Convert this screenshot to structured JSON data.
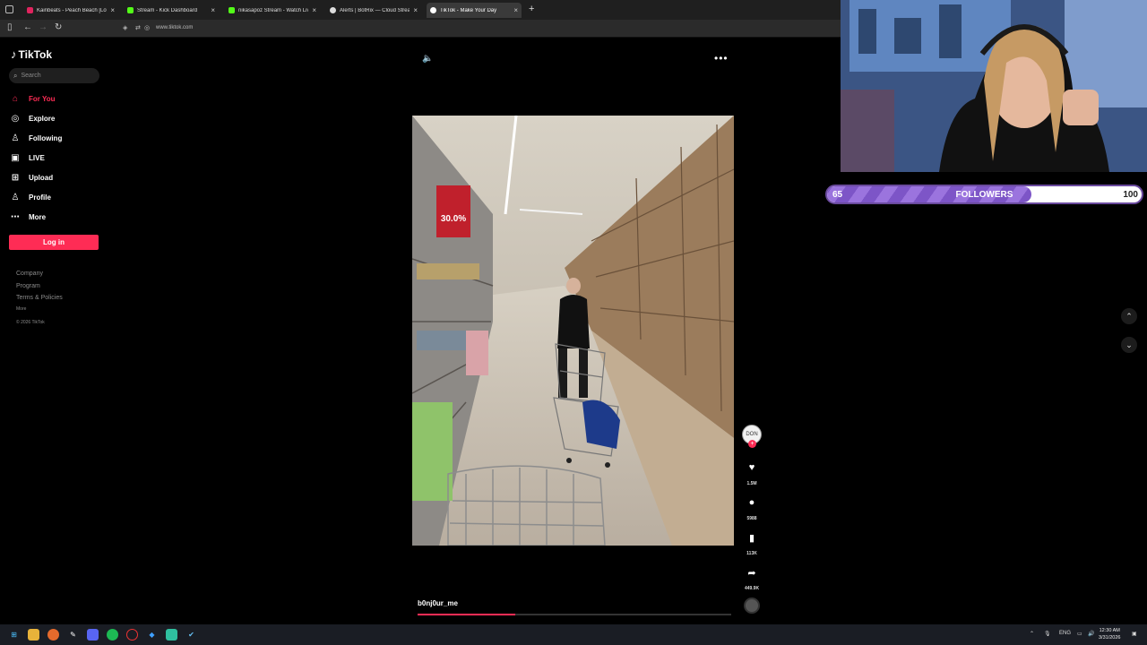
{
  "browser": {
    "tabs": [
      {
        "title": "Kainbeats - Peach Beach [Lofi H",
        "favicon_color": "#e0245e"
      },
      {
        "title": "Stream - Kick Dashboard",
        "favicon_color": "#53fc18"
      },
      {
        "title": "nikasapoz Stream - Watch Live",
        "favicon_color": "#53fc18"
      },
      {
        "title": "Alerts | BotRix — Cloud Stream",
        "favicon_color": "#dddddd"
      },
      {
        "title": "TikTok - Make Your Day",
        "favicon_color": "#ffffff"
      }
    ],
    "active_tab": 4,
    "url": "www.tiktok.com"
  },
  "tiktok": {
    "logo": "TikTok",
    "search_placeholder": "Search",
    "nav": [
      {
        "label": "For You",
        "icon": "home-icon",
        "active": true
      },
      {
        "label": "Explore",
        "icon": "compass-icon",
        "active": false
      },
      {
        "label": "Following",
        "icon": "user-follow-icon",
        "active": false
      },
      {
        "label": "LIVE",
        "icon": "live-icon",
        "active": false
      },
      {
        "label": "Upload",
        "icon": "upload-icon",
        "active": false
      },
      {
        "label": "Profile",
        "icon": "profile-icon",
        "active": false
      },
      {
        "label": "More",
        "icon": "more-icon",
        "active": false
      }
    ],
    "login_label": "Log in",
    "footer": {
      "company": "Company",
      "program": "Program",
      "terms": "Terms & Policies",
      "more": "More",
      "copyright": "© 2026 TikTok"
    },
    "video": {
      "username": "b0nj0ur_me",
      "avatar_text": "DON",
      "likes": "1.5M",
      "comments": "5988",
      "saves": "113K",
      "shares": "449.9K",
      "progress": 0.31,
      "sign_text": "30.0%"
    }
  },
  "overlay": {
    "goal_label": "FOLLOWERS",
    "goal_current": "65",
    "goal_target": "100",
    "goal_fraction": 0.65
  },
  "taskbar": {
    "lang": "ENG",
    "time": "12:30 AM",
    "date": "3/31/2026"
  },
  "colors": {
    "accent": "#fe2c55",
    "goal_purple": "#7d55c7"
  }
}
